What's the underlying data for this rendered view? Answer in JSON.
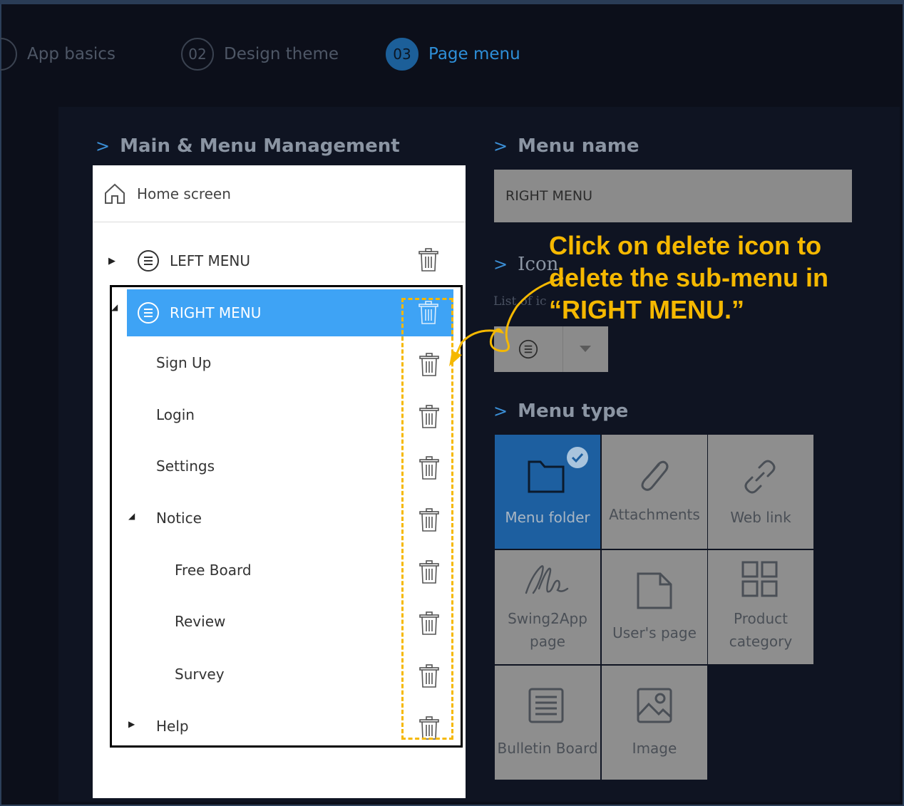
{
  "steps": [
    {
      "label": "App basics"
    },
    {
      "num": "02",
      "label": "Design theme"
    },
    {
      "num": "03",
      "label": "Page menu"
    }
  ],
  "sections": {
    "main_menu": "Main & Menu Management",
    "menu_name": "Menu name",
    "icon": "Icon",
    "menu_type": "Menu type"
  },
  "tree": {
    "home": "Home screen",
    "items": [
      {
        "label": "LEFT MENU"
      },
      {
        "label": "RIGHT MENU"
      },
      {
        "label": "Sign Up"
      },
      {
        "label": "Login"
      },
      {
        "label": "Settings"
      },
      {
        "label": "Notice"
      },
      {
        "label": "Free Board"
      },
      {
        "label": "Review"
      },
      {
        "label": "Survey"
      },
      {
        "label": "Help"
      }
    ]
  },
  "menu_name_value": "RIGHT MENU",
  "icon_hint": "List of ic",
  "menu_types": [
    {
      "label": "Menu folder"
    },
    {
      "label": "Attachments"
    },
    {
      "label": "Web link"
    },
    {
      "label1": "Swing2App",
      "label2": "page"
    },
    {
      "label": "User's page"
    },
    {
      "label1": "Product",
      "label2": "category"
    },
    {
      "label": "Bulletin Board"
    },
    {
      "label": "Image"
    }
  ],
  "annotation": {
    "line1": "Click on delete icon to",
    "line2": "delete the sub-menu in",
    "line3": "“RIGHT MENU.”"
  },
  "colors": {
    "accent": "#3ea3f5",
    "annotation": "#f5b800",
    "active_type": "#1d5fa0"
  }
}
